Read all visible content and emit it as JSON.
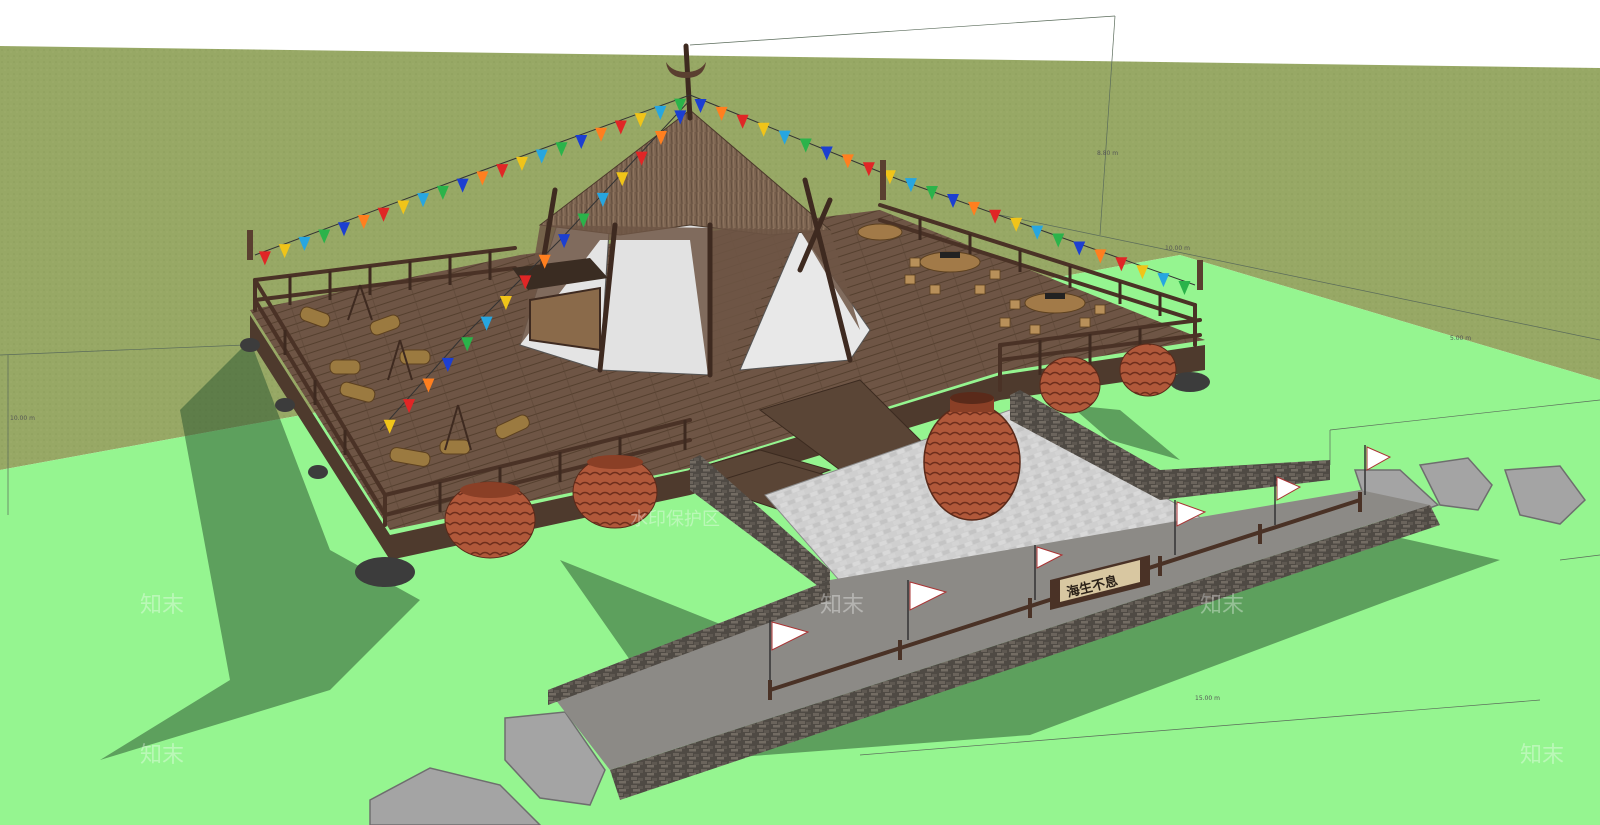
{
  "scene": {
    "sign_text": "海生不息",
    "watermark_text": "水印保护区",
    "watermark_logo": "知末",
    "dimension_labels": [
      "8.80 m",
      "10.00 m",
      "5.00 m",
      "10.00 m",
      "15.00 m"
    ]
  },
  "colors": {
    "ground_grass": "#97a865",
    "ground_selected": "#95f590",
    "deck_wood": "#6e5545",
    "railing": "#4a3226",
    "thatch": "#7b6350",
    "canvas_white": "#e4e4e4",
    "stone_wall": "#4f4a44",
    "paving": "#c9c9c9",
    "pot_clay": "#b0583a"
  },
  "icons": [
    "bunting-flags",
    "clay-pot",
    "stepping-stone",
    "flag-pole",
    "log-stool",
    "bonfire"
  ]
}
